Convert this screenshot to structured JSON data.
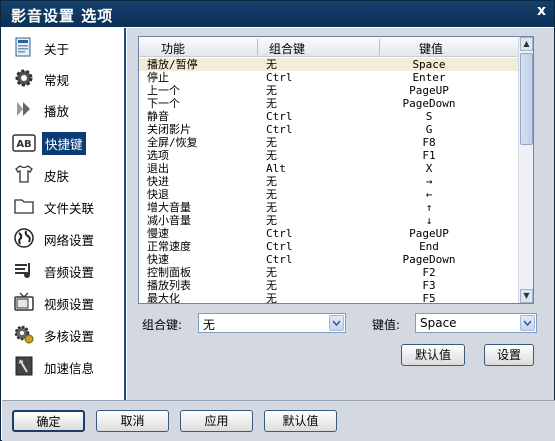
{
  "window": {
    "title": "影音设置 选项",
    "close_label": "x"
  },
  "sidebar": {
    "items": [
      {
        "label": "关于",
        "icon": "info-icon"
      },
      {
        "label": "常规",
        "icon": "gear-icon"
      },
      {
        "label": "播放",
        "icon": "play-arrow-icon"
      },
      {
        "label": "快捷键",
        "icon": "keyboard-ab-icon",
        "active": true
      },
      {
        "label": "皮肤",
        "icon": "shirt-icon"
      },
      {
        "label": "文件关联",
        "icon": "folder-icon"
      },
      {
        "label": "网络设置",
        "icon": "globe-icon"
      },
      {
        "label": "音频设置",
        "icon": "audio-icon"
      },
      {
        "label": "视频设置",
        "icon": "tv-icon"
      },
      {
        "label": "多核设置",
        "icon": "cpu-gear-icon"
      },
      {
        "label": "加速信息",
        "icon": "speed-icon"
      }
    ]
  },
  "hotkeys": {
    "columns": [
      "功能",
      "组合键",
      "键值"
    ],
    "rows": [
      {
        "func": "播放/暂停",
        "mod": "无",
        "key": "Space"
      },
      {
        "func": "停止",
        "mod": "Ctrl",
        "key": "Enter"
      },
      {
        "func": "上一个",
        "mod": "无",
        "key": "PageUP"
      },
      {
        "func": "下一个",
        "mod": "无",
        "key": "PageDown"
      },
      {
        "func": "静音",
        "mod": "Ctrl",
        "key": "S"
      },
      {
        "func": "关闭影片",
        "mod": "Ctrl",
        "key": "G"
      },
      {
        "func": "全屏/恢复",
        "mod": "无",
        "key": "F8"
      },
      {
        "func": "选项",
        "mod": "无",
        "key": "F1"
      },
      {
        "func": "退出",
        "mod": "Alt",
        "key": "X"
      },
      {
        "func": "快进",
        "mod": "无",
        "key": "→"
      },
      {
        "func": "快退",
        "mod": "无",
        "key": "←"
      },
      {
        "func": "增大音量",
        "mod": "无",
        "key": "↑"
      },
      {
        "func": "减小音量",
        "mod": "无",
        "key": "↓"
      },
      {
        "func": "慢速",
        "mod": "Ctrl",
        "key": "PageUP"
      },
      {
        "func": "正常速度",
        "mod": "Ctrl",
        "key": "End"
      },
      {
        "func": "快速",
        "mod": "Ctrl",
        "key": "PageDown"
      },
      {
        "func": "控制面板",
        "mod": "无",
        "key": "F2"
      },
      {
        "func": "播放列表",
        "mod": "无",
        "key": "F3"
      },
      {
        "func": "最大化",
        "mod": "无",
        "key": "F5"
      }
    ]
  },
  "editor": {
    "modifier_label": "组合键:",
    "modifier_value": "无",
    "key_label": "键值:",
    "key_value": "Space",
    "default_button": "默认值",
    "set_button": "设置"
  },
  "footer": {
    "ok_button": "确定",
    "cancel_button": "取消",
    "apply_button": "应用",
    "default_button": "默认值"
  },
  "colors": {
    "titlebar": "#0c2f55",
    "active_nav": "#0a3d75",
    "panel_bg": "#d4d8e1",
    "selected_row": "#f3ecd8"
  }
}
